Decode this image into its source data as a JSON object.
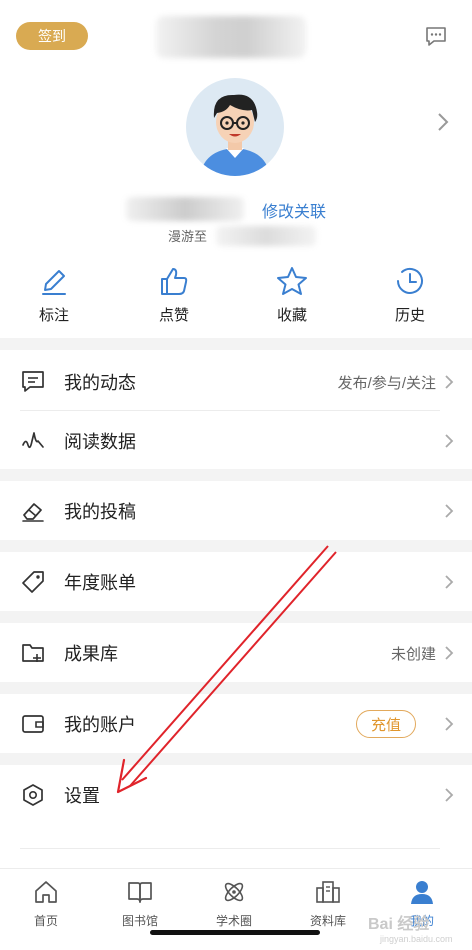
{
  "header": {
    "checkin_label": "签到",
    "edit_link": "修改关联",
    "roam_label": "漫游至"
  },
  "quick_actions": [
    {
      "label": "标注",
      "icon": "pencil-icon"
    },
    {
      "label": "点赞",
      "icon": "thumbs-up-icon"
    },
    {
      "label": "收藏",
      "icon": "star-icon"
    },
    {
      "label": "历史",
      "icon": "history-clock-icon"
    }
  ],
  "menu": {
    "my_activity": {
      "label": "我的动态",
      "right": "发布/参与/关注"
    },
    "reading_data": {
      "label": "阅读数据"
    },
    "my_submissions": {
      "label": "我的投稿"
    },
    "annual_bill": {
      "label": "年度账单"
    },
    "results_library": {
      "label": "成果库",
      "right": "未创建"
    },
    "my_account": {
      "label": "我的账户",
      "button": "充值"
    },
    "settings": {
      "label": "设置"
    }
  },
  "tabs": [
    {
      "label": "首页",
      "icon": "home-icon"
    },
    {
      "label": "图书馆",
      "icon": "book-icon"
    },
    {
      "label": "学术圈",
      "icon": "atom-icon"
    },
    {
      "label": "资料库",
      "icon": "buildings-icon"
    },
    {
      "label": "我的",
      "icon": "user-icon",
      "active": true
    }
  ],
  "watermark": {
    "main": "Bai 经验",
    "sub": "jingyan.baidu.com"
  },
  "colors": {
    "accent": "#3a7fd0",
    "checkin": "#d9aa52",
    "recharge": "#e0962e",
    "annotation_arrow": "#e0242b"
  }
}
